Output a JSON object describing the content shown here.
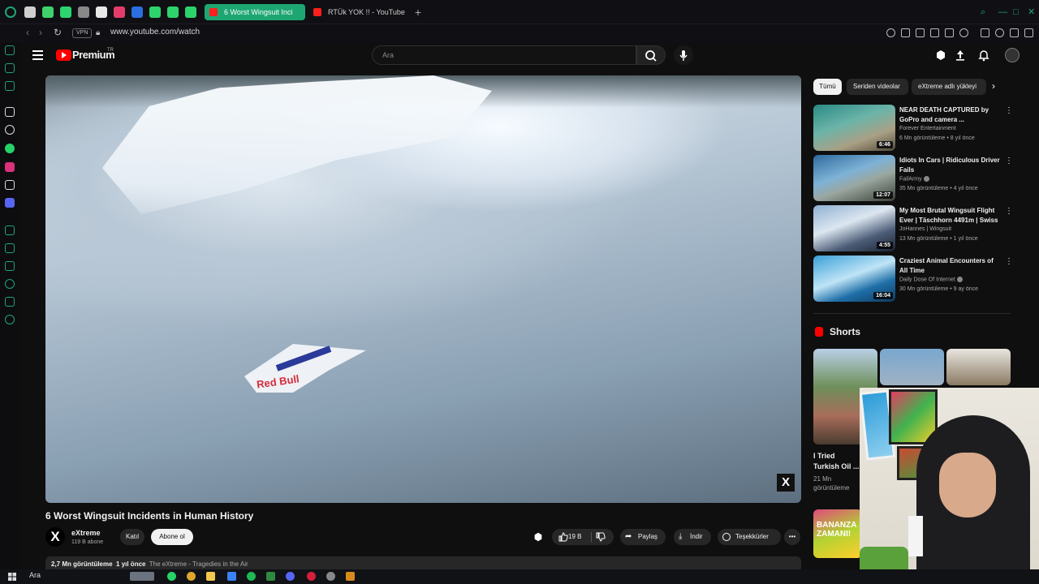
{
  "browser": {
    "tabs": [
      {
        "title": "6 Worst Wingsuit Inci",
        "active": true
      },
      {
        "title": "RTÜk YOK !! - YouTube",
        "active": false
      }
    ],
    "address": {
      "vpn_label": "VPN",
      "url": "www.youtube.com/watch"
    },
    "accent_color": "#1ea672"
  },
  "youtube": {
    "logo_text": "Premium",
    "logo_superscript": "TR",
    "search": {
      "placeholder": "Ara"
    },
    "video": {
      "title": "6 Worst Wingsuit Incidents in Human History",
      "jersey_text": "Red Bull",
      "watermark": "X",
      "channel": {
        "avatar_letter": "X",
        "name": "eXtreme",
        "subscribers": "119 B abone"
      },
      "join_label": "Katıl",
      "subscribe_label": "Abone ol",
      "likes": "19 B",
      "share_label": "Paylaş",
      "download_label": "İndir",
      "thanks_label": "Teşekkürler",
      "more_label": "•••",
      "description": {
        "views": "2,7 Mn görüntüleme",
        "age": "1 yıl önce",
        "extra": "The eXtreme - Tragedies in the Air"
      }
    },
    "chips": {
      "all": "Tümü",
      "series": "Seriden videolar",
      "channel": "eXtreme adlı yükleyi",
      "next": "›"
    },
    "recommendations": [
      {
        "title": "NEAR DEATH CAPTURED by GoPro and camera ...",
        "channel": "Forever Entertainment",
        "meta": "6 Mn görüntüleme • 8 yıl önce",
        "duration": "6:46",
        "verified": false
      },
      {
        "title": "Idiots In Cars | Ridiculous Driver Fails",
        "channel": "FailArmy",
        "meta": "35 Mn görüntüleme • 4 yıl önce",
        "duration": "12:07",
        "verified": true
      },
      {
        "title": "My Most Brutal Wingsuit Flight Ever | Täschhorn 4491m | Swiss",
        "channel": "JoHannes | Wingsuit",
        "meta": "13 Mn görüntüleme • 1 yıl önce",
        "duration": "4:55",
        "verified": false
      },
      {
        "title": "Craziest Animal Encounters of All Time",
        "channel": "Daily Dose Of Internet",
        "meta": "30 Mn görüntüleme • 9 ay önce",
        "duration": "16:04",
        "verified": true
      }
    ],
    "menu_glyph": "⋮",
    "shorts": {
      "heading": "Shorts",
      "first_title": "I Tried Turkish Oil ...",
      "first_views": "21 Mn görüntüleme",
      "next_banner": "BANANZA ZAMANI!"
    }
  },
  "taskbar": {
    "search_label": "Ara"
  }
}
